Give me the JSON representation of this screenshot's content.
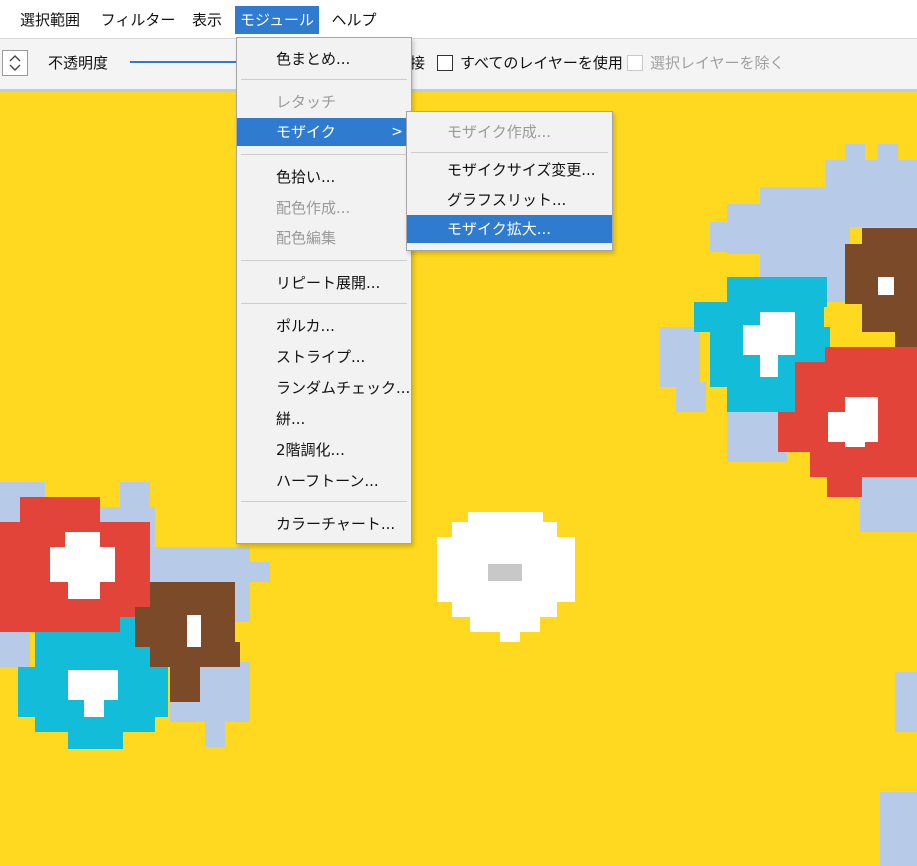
{
  "menubar": {
    "items": [
      "選択範囲",
      "フィルター",
      "表示",
      "モジュール",
      "ヘルプ"
    ],
    "active_index": 3
  },
  "toolbar": {
    "opacity_label": "不透明度",
    "partial_label": "接",
    "use_all_layers": "すべてのレイヤーを使用",
    "exclude_selected_layers": "選択レイヤーを除く"
  },
  "module_menu": {
    "items": [
      {
        "label": "色まとめ...",
        "disabled": false
      },
      {
        "label": "レタッチ",
        "disabled": true
      },
      {
        "label": "モザイク",
        "disabled": false,
        "submenu": true,
        "highlighted": true
      },
      {
        "label": "色拾い...",
        "disabled": false
      },
      {
        "label": "配色作成...",
        "disabled": true
      },
      {
        "label": "配色編集",
        "disabled": true
      },
      {
        "label": "リピート展開...",
        "disabled": false
      },
      {
        "label": "ポルカ...",
        "disabled": false
      },
      {
        "label": "ストライプ...",
        "disabled": false
      },
      {
        "label": "ランダムチェック...",
        "disabled": false
      },
      {
        "label": "絣...",
        "disabled": false
      },
      {
        "label": "2階調化...",
        "disabled": false
      },
      {
        "label": "ハーフトーン...",
        "disabled": false
      },
      {
        "label": "カラーチャート...",
        "disabled": false
      }
    ],
    "submenu_arrow": ">"
  },
  "mosaic_submenu": {
    "items": [
      {
        "label": "モザイク作成...",
        "disabled": true
      },
      {
        "label": "モザイクサイズ変更...",
        "disabled": false
      },
      {
        "label": "グラフスリット...",
        "disabled": false
      },
      {
        "label": "モザイク拡大...",
        "disabled": false,
        "highlighted": true
      }
    ]
  },
  "colors": {
    "background": "#FFD91F",
    "accent": "#2e7bcf",
    "pale_blue": "#B7CBE8",
    "cyan": "#13BCD8",
    "red": "#E2443A",
    "brown": "#7B4A28",
    "white": "#FFFFFF",
    "gray": "#C8C8C8"
  }
}
